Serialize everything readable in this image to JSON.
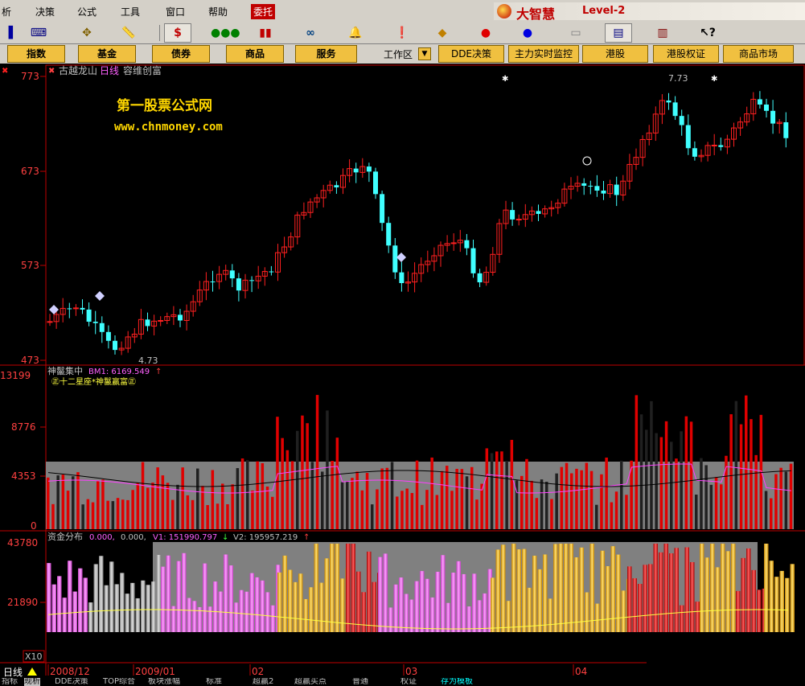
{
  "menu": {
    "items": [
      "析",
      "决策",
      "公式",
      "工具",
      "窗口",
      "帮助",
      "委托"
    ],
    "active_item": "委托",
    "brand": {
      "name": "大智慧",
      "level": "Level-2"
    }
  },
  "toolbar": {
    "icons": [
      "window-icon",
      "keyboard-icon",
      "move-icon",
      "ruler-icon",
      "dollar-icon",
      "traffic-light-icon",
      "bars-icon",
      "binoculars-icon",
      "bell-icon",
      "alert-icon",
      "diamond-icon",
      "red-ball-icon",
      "blue-ball-icon",
      "print-icon",
      "layout-icon",
      "books-icon",
      "help-pointer-icon"
    ],
    "dollar_glyph": "$"
  },
  "function_bar": {
    "buttons": [
      "指数",
      "基金",
      "债券",
      "商品",
      "服务"
    ],
    "work_area_label": "工作区",
    "quick_links": [
      "DDE决策",
      "主力实时监控",
      "港股",
      "港股权证",
      "商品市场"
    ]
  },
  "price_panel": {
    "stock_name": "古越龙山",
    "period": "日线",
    "tag": "容维创富",
    "y_ticks": [
      "773",
      "673",
      "573",
      "473"
    ],
    "low_label": "4.73",
    "high_label": "7.73",
    "watermark_line1": "第一股票公式网",
    "watermark_line2": "www.chnmoney.com"
  },
  "volume_panel": {
    "title": "神鬣集中",
    "indicator": "BM1: 6169.549",
    "arrow": "↑",
    "subtitle": "㊣十二星座*神鬣赢富㊣",
    "y_ticks": [
      "13199",
      "8776",
      "4353",
      "0"
    ]
  },
  "capital_panel": {
    "title": "资金分布",
    "v0": "0.000,",
    "v00": "0.000,",
    "v1": "V1: 151990.797",
    "v1_arrow": "↓",
    "v2": "V2: 195957.219",
    "v2_arrow": "↑",
    "y_ticks": [
      "43780",
      "21890"
    ],
    "multiplier": "X10"
  },
  "time_axis": {
    "period_label": "日线",
    "labels": [
      "2008/12",
      "2009/01",
      "02",
      "03",
      "04"
    ]
  },
  "status_bar": {
    "tabs": [
      "指标",
      "现析",
      "DDE决策",
      "TOP综合",
      "板块涨幅",
      "标准",
      "超赢2",
      "超赢买点",
      "普通",
      "权证",
      "存为模板"
    ],
    "active_tab": "现析",
    "highlight_tab": "存为模板"
  },
  "colors": {
    "up": "#ff2020",
    "down": "#40ffff",
    "axis": "#c00000",
    "watermark": "#ffd700",
    "volume_up": "#e00000",
    "gray_band": "#808080",
    "pink": "#ff60ff",
    "gold": "#f0c020"
  }
}
